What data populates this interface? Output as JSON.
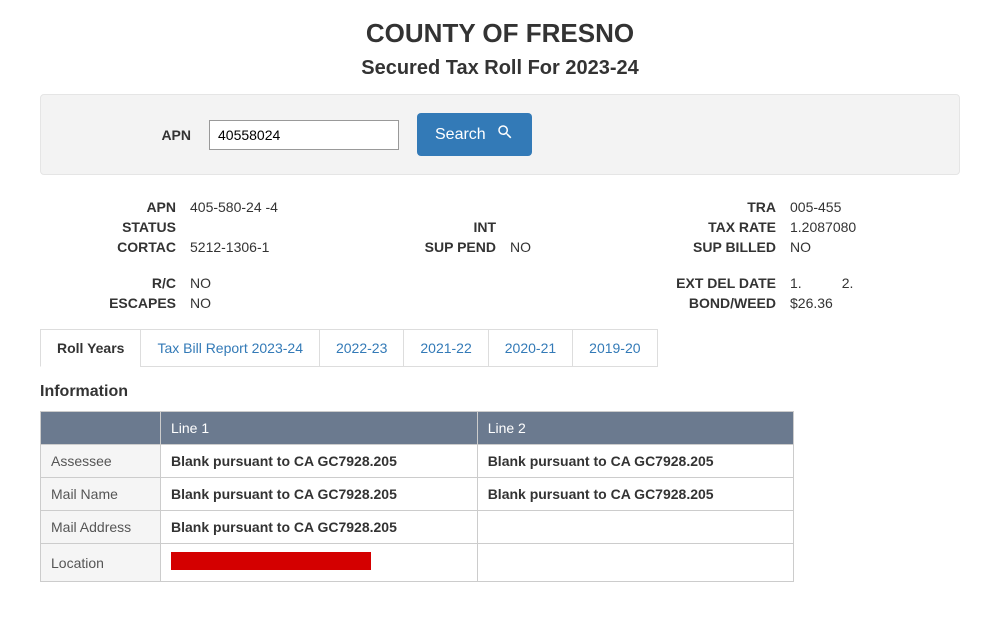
{
  "header": {
    "title": "COUNTY OF FRESNO",
    "subtitle": "Secured Tax Roll For 2023-24"
  },
  "search": {
    "label": "APN",
    "value": "40558024",
    "button": "Search"
  },
  "details": {
    "apn_label": "APN",
    "apn_value": "405-580-24 -4",
    "status_label": "STATUS",
    "status_value": "",
    "cortac_label": "CORTAC",
    "cortac_value": "5212-1306-1",
    "int_label": "INT",
    "int_value": "",
    "suppend_label": "SUP PEND",
    "suppend_value": "NO",
    "tra_label": "TRA",
    "tra_value": "005-455",
    "taxrate_label": "TAX RATE",
    "taxrate_value": "1.2087080",
    "supbilled_label": "SUP BILLED",
    "supbilled_value": "NO",
    "rc_label": "R/C",
    "rc_value": "NO",
    "escapes_label": "ESCAPES",
    "escapes_value": "NO",
    "extdel_label": "EXT DEL DATE",
    "extdel_value1": "1.",
    "extdel_value2": "2.",
    "bondweed_label": "BOND/WEED",
    "bondweed_value": "$26.36"
  },
  "tabs": {
    "roll_years": "Roll Years",
    "tax_bill_report": "Tax Bill Report  2023-24",
    "y2022": "2022-23",
    "y2021": "2021-22",
    "y2020": "2020-21",
    "y2019": "2019-20"
  },
  "info": {
    "section_title": "Information",
    "col_blank": "",
    "col_line1": "Line 1",
    "col_line2": "Line 2",
    "rows": {
      "assessee_label": "Assessee",
      "assessee_line1": "Blank pursuant to CA GC7928.205",
      "assessee_line2": "Blank pursuant to CA GC7928.205",
      "mailname_label": "Mail Name",
      "mailname_line1": "Blank pursuant to CA GC7928.205",
      "mailname_line2": "Blank pursuant to CA GC7928.205",
      "mailaddr_label": "Mail Address",
      "mailaddr_line1": "Blank pursuant to CA GC7928.205",
      "mailaddr_line2": "",
      "location_label": "Location",
      "location_line2": ""
    }
  }
}
